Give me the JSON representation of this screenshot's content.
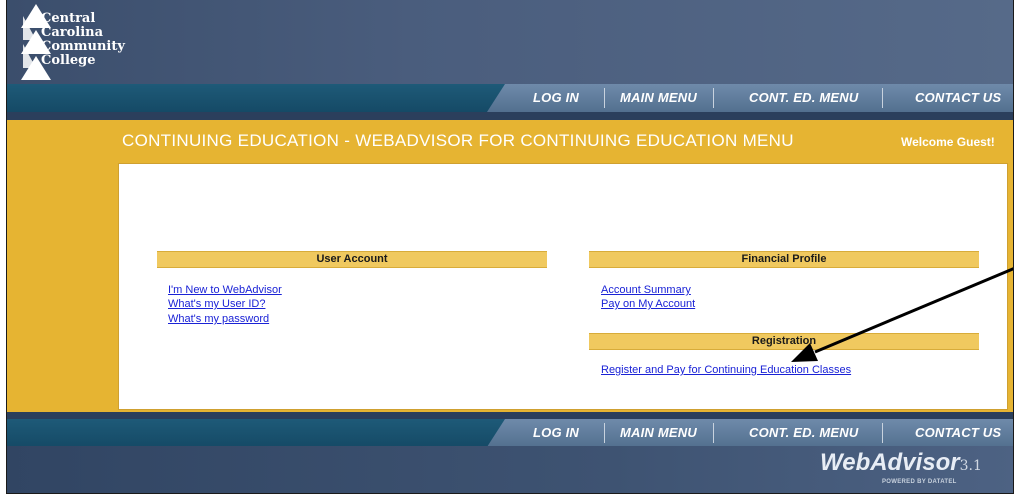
{
  "logo": {
    "lines": [
      "Central",
      "Carolina",
      "Community",
      "College"
    ]
  },
  "nav": {
    "items": [
      "LOG IN",
      "MAIN MENU",
      "CONT. ED. MENU",
      "CONTACT US"
    ]
  },
  "page": {
    "title": "CONTINUING EDUCATION - WEBADVISOR FOR CONTINUING EDUCATION MENU",
    "welcome": "Welcome Guest!"
  },
  "sections": {
    "user_account": {
      "title": "User Account",
      "links": [
        "I'm New to WebAdvisor",
        "What's my User ID?",
        "What's my password"
      ]
    },
    "financial_profile": {
      "title": "Financial Profile",
      "links": [
        "Account Summary",
        "Pay on My Account"
      ]
    },
    "registration": {
      "title": "Registration",
      "links": [
        "Register and Pay for Continuing Education Classes"
      ]
    }
  },
  "footer_logo": {
    "name": "WebAdvisor",
    "version": "3.1",
    "tagline": "POWERED BY DATATEL"
  },
  "colors": {
    "gold": "#e6b432",
    "header_blue": "#4a5d7d",
    "nav_teal": "#1e5a78",
    "link": "#1a22d6"
  }
}
